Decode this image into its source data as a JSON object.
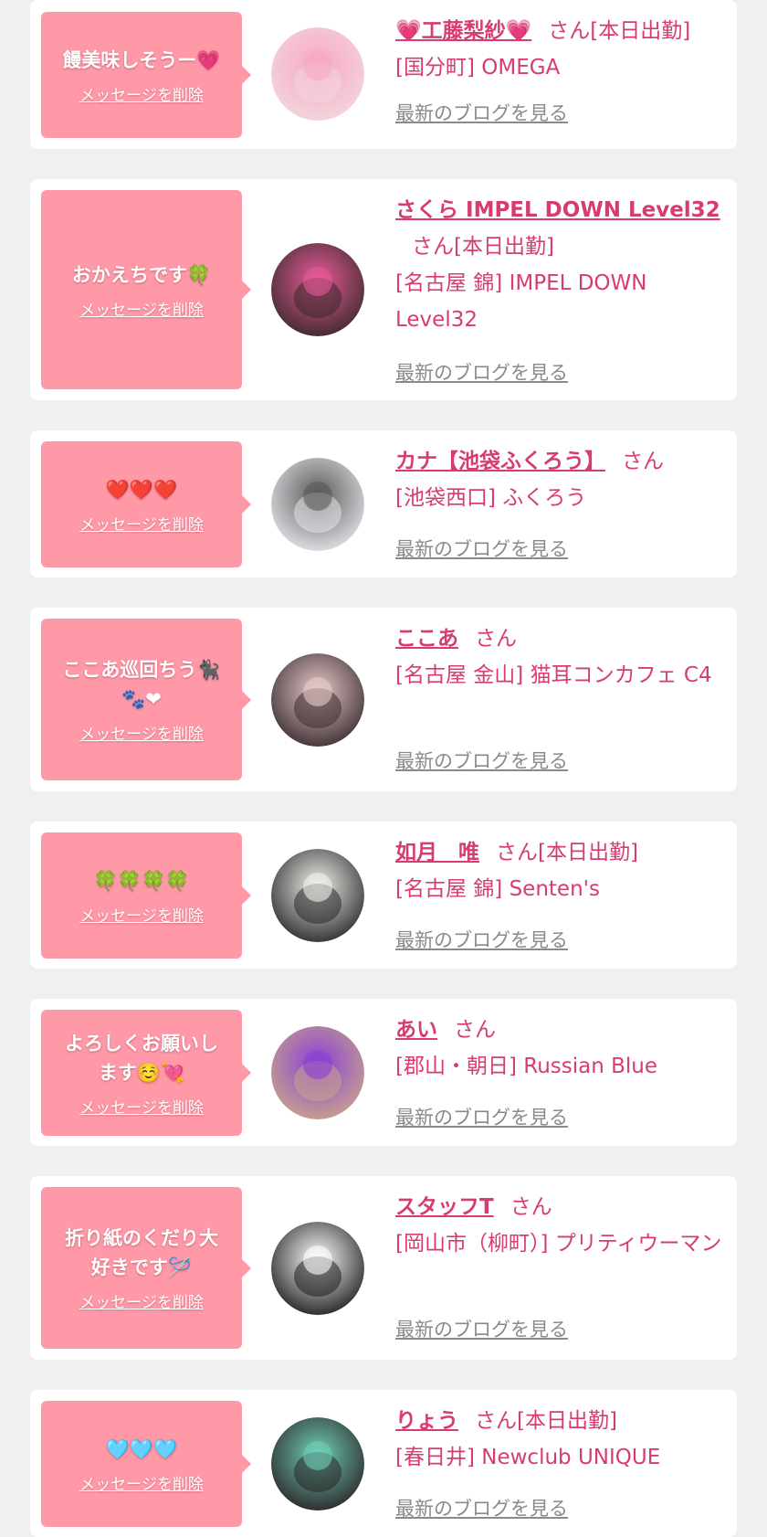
{
  "ui": {
    "delete_label": "メッセージを削除",
    "blog_label": "最新のブログを見る",
    "san": "さん",
    "on_duty": "[本日出勤]"
  },
  "messages": [
    {
      "bubble_lines": [
        "饅美味しそうー💗"
      ],
      "name": "💗工藤梨紗💗",
      "on_duty": true,
      "shop": "[国分町] OMEGA",
      "avatar_colors": [
        "#f3d6dc",
        "#f7a8c4"
      ]
    },
    {
      "bubble_lines": [
        "おかえちです🍀"
      ],
      "name": "さくら IMPEL DOWN Level32",
      "on_duty": true,
      "shop": "[名古屋 錦] IMPEL DOWN Level32",
      "avatar_colors": [
        "#3a2a2a",
        "#e85a9a"
      ]
    },
    {
      "bubble_lines": [
        "❤️❤️❤️"
      ],
      "name": "カナ【池袋ふくろう】",
      "on_duty": false,
      "shop": "[池袋西口] ふくろう",
      "avatar_colors": [
        "#e8e4ea",
        "#5a5a5a"
      ]
    },
    {
      "bubble_lines": [
        "ここあ巡回ちう🐈‍⬛",
        "🐾❤"
      ],
      "name": "ここあ",
      "on_duty": false,
      "shop": "[名古屋 金山] 猫耳コンカフェ C4",
      "avatar_colors": [
        "#3a2c30",
        "#e7c9c9"
      ]
    },
    {
      "bubble_lines": [
        "🍀🍀🍀🍀"
      ],
      "name": "如月　唯",
      "on_duty": true,
      "shop": "[名古屋 錦] Senten's",
      "avatar_colors": [
        "#2a2a2a",
        "#f2f0ec"
      ]
    },
    {
      "bubble_lines": [
        "よろしくお願いし",
        "ます☺️💘"
      ],
      "name": "あい",
      "on_duty": false,
      "shop": "[郡山・朝日] Russian Blue",
      "avatar_colors": [
        "#c9a58a",
        "#8a3fd6"
      ]
    },
    {
      "bubble_lines": [
        "折り紙のくだり大",
        "好きです🪡"
      ],
      "name": "スタッフT",
      "on_duty": false,
      "shop": "[岡山市（柳町）] プリティウーマン",
      "avatar_colors": [
        "#1e1e1e",
        "#ffffff"
      ]
    },
    {
      "bubble_lines": [
        "🩵🩵🩵"
      ],
      "name": "りょう",
      "on_duty": true,
      "shop": "[春日井] Newclub UNIQUE",
      "avatar_colors": [
        "#2a2426",
        "#6fcfb8"
      ]
    }
  ]
}
